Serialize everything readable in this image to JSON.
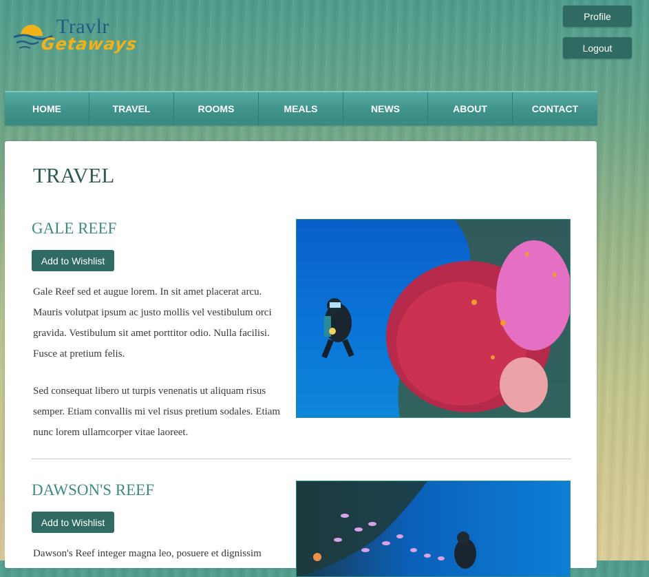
{
  "logo": {
    "line1": "Travlr",
    "line2": "Getaways"
  },
  "header": {
    "profile_label": "Profile",
    "logout_label": "Logout"
  },
  "nav": {
    "items": [
      "HOME",
      "TRAVEL",
      "ROOMS",
      "MEALS",
      "NEWS",
      "ABOUT",
      "CONTACT"
    ]
  },
  "page": {
    "title": "TRAVEL"
  },
  "trips": [
    {
      "name": "GALE REEF",
      "wishlist_label": "Add to Wishlist",
      "paragraphs": [
        "Gale Reef sed et augue lorem. In sit amet placerat arcu. Mauris volutpat ipsum ac justo mollis vel vestibulum orci gravida. Vestibulum sit amet porttitor odio. Nulla facilisi. Fusce at pretium felis.",
        "Sed consequat libero ut turpis venenatis ut aliquam risus semper. Etiam convallis mi vel risus pretium sodales. Etiam nunc lorem ullamcorper vitae laoreet."
      ]
    },
    {
      "name": "DAWSON'S REEF",
      "wishlist_label": "Add to Wishlist",
      "paragraphs": [
        "Dawson's Reef integer magna leo, posuere et dignissim"
      ]
    }
  ],
  "colors": {
    "accent": "#2f6b62",
    "nav": "#3f9289",
    "heading": "#3e8a83"
  }
}
